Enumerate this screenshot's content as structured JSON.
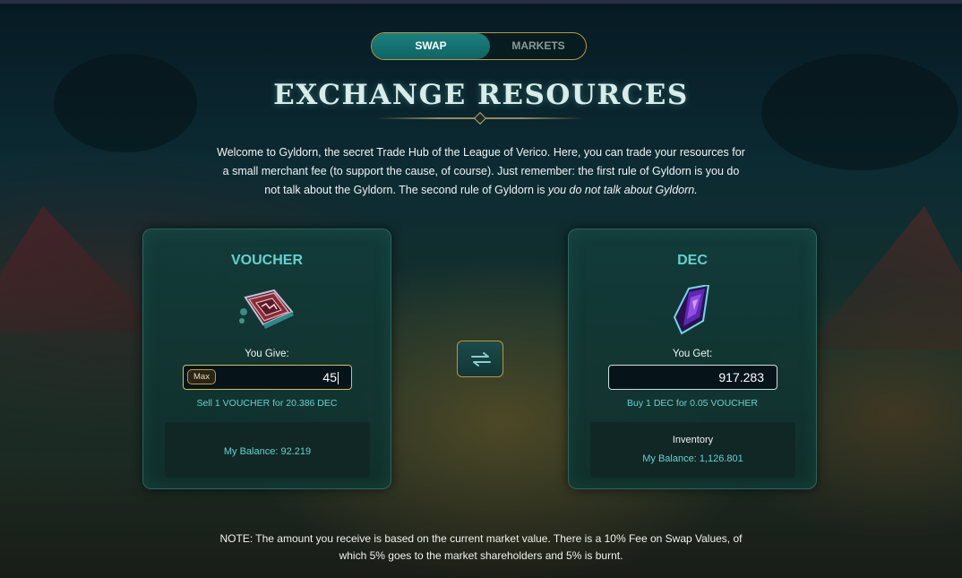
{
  "toggle": {
    "swap_label": "SWAP",
    "markets_label": "MARKETS"
  },
  "page": {
    "title": "EXCHANGE RESOURCES",
    "intro_main": "Welcome to Gyldorn, the secret Trade Hub of the League of Verico. Here, you can trade your resources for a small merchant fee (to support the cause, of course). Just remember: the first rule of Gyldorn is you do not talk about the Gyldorn. The second rule of Gyldorn is ",
    "intro_emphasis": "you do not talk about Gyldorn."
  },
  "give_card": {
    "title": "VOUCHER",
    "icon": "voucher-book-icon",
    "label": "You Give:",
    "max_label": "Max",
    "amount": "45",
    "rate": "Sell 1 VOUCHER for 20.386 DEC",
    "balance": "My Balance: 92.219"
  },
  "get_card": {
    "title": "DEC",
    "icon": "dec-crystal-icon",
    "label": "You Get:",
    "amount": "917.283",
    "rate": "Buy 1 DEC for 0.05 VOUCHER",
    "inventory_label": "Inventory",
    "balance": "My Balance: 1,126.801"
  },
  "swap_icon": "swap-arrows-icon",
  "note": "NOTE: The amount you receive is based on the current market value. There is a 10% Fee on Swap Values, of which 5% goes to the market shareholders and 5% is burnt.",
  "colors": {
    "accent_teal": "#5fd4d2",
    "gold_border": "#b89a3c",
    "toggle_active": "#0f6464"
  }
}
